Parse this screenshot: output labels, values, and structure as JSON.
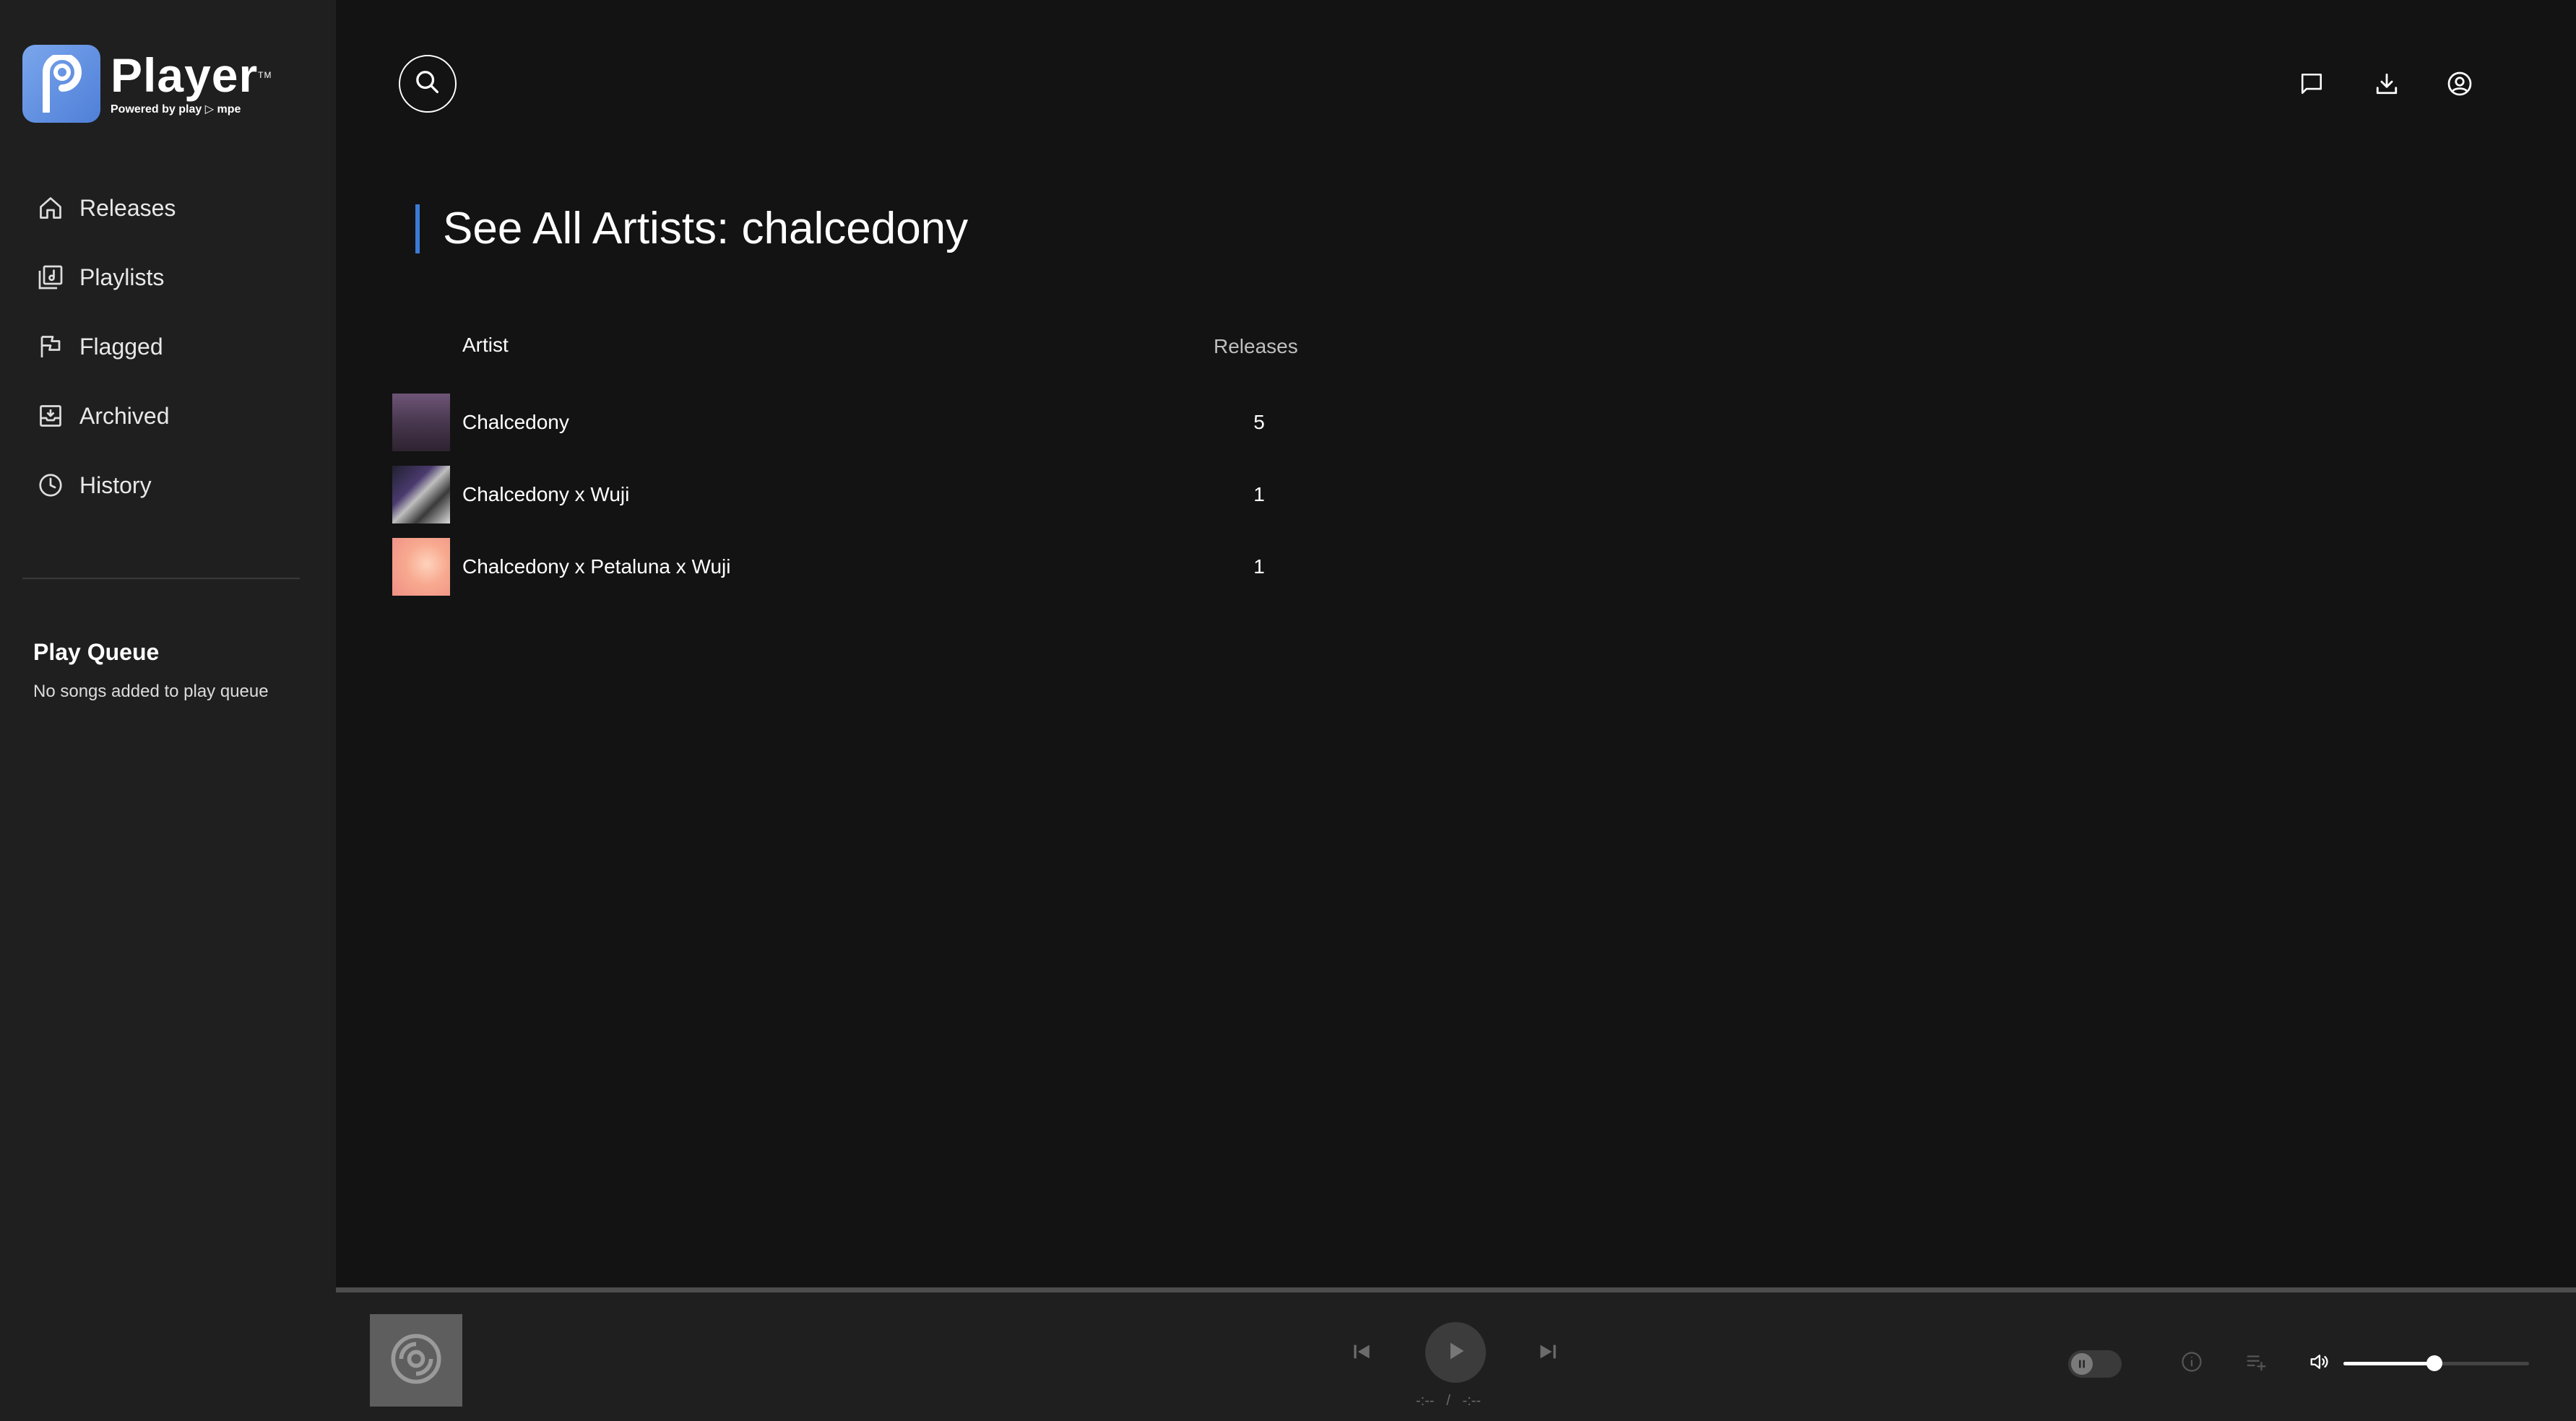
{
  "brand": {
    "name": "Player",
    "tm": "TM",
    "tagline": "Powered by play ▷ mpe"
  },
  "nav": [
    {
      "label": "Releases",
      "icon": "home-icon"
    },
    {
      "label": "Playlists",
      "icon": "playlist-icon"
    },
    {
      "label": "Flagged",
      "icon": "flag-icon"
    },
    {
      "label": "Archived",
      "icon": "archive-icon"
    },
    {
      "label": "History",
      "icon": "clock-icon"
    }
  ],
  "queue": {
    "title": "Play Queue",
    "empty": "No songs added to play queue"
  },
  "header": {
    "icons": [
      "search-icon",
      "message-icon",
      "download-icon",
      "account-icon"
    ]
  },
  "page": {
    "title": "See All Artists: chalcedony"
  },
  "table": {
    "headers": {
      "artist": "Artist",
      "releases": "Releases"
    },
    "rows": [
      {
        "name": "Chalcedony",
        "releases": "5"
      },
      {
        "name": "Chalcedony x Wuji",
        "releases": "1"
      },
      {
        "name": "Chalcedony x Petaluna x Wuji",
        "releases": "1"
      }
    ]
  },
  "player": {
    "current_time": "-:--",
    "separator": "/",
    "duration": "-:--",
    "volume": 0.49,
    "icons": [
      "disc-icon",
      "previous-icon",
      "play-icon",
      "next-icon",
      "info-icon",
      "queue-add-icon",
      "volume-icon"
    ]
  },
  "colors": {
    "accent": "#3b7bd6",
    "background": "#131313",
    "sidebar": "#1f1f1f"
  }
}
